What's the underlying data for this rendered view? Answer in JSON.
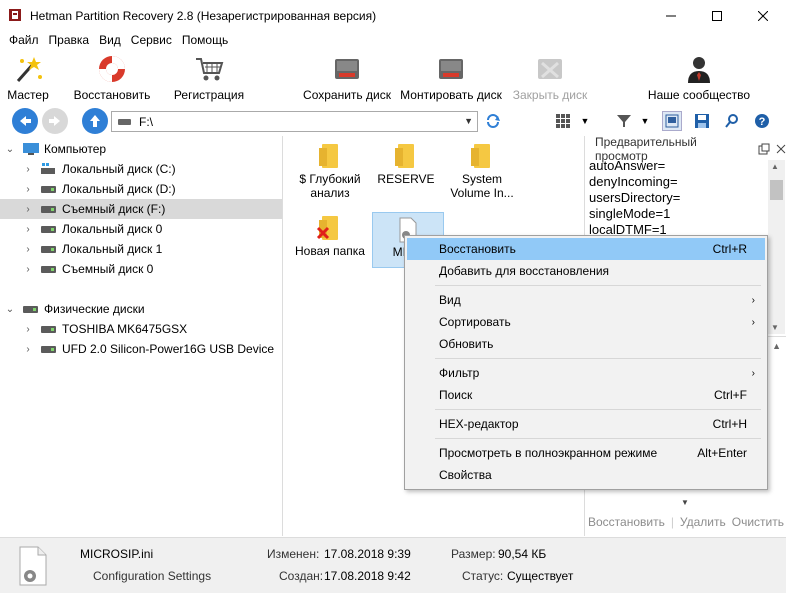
{
  "window": {
    "title": "Hetman Partition Recovery 2.8 (Незарегистрированная версия)",
    "minimize": "—",
    "maximize": "☐",
    "close": "✕"
  },
  "menu": [
    "Файл",
    "Правка",
    "Вид",
    "Сервис",
    "Помощь"
  ],
  "toolbar": {
    "wizard": "Мастер",
    "restore": "Восстановить",
    "register": "Регистрация",
    "save_disk": "Сохранить диск",
    "mount_disk": "Монтировать диск",
    "close_disk": "Закрыть диск",
    "community": "Наше сообщество"
  },
  "address": {
    "path": "F:\\"
  },
  "tree": {
    "computer": "Компьютер",
    "drives": [
      "Локальный диск (C:)",
      "Локальный диск (D:)",
      "Съемный диск (F:)",
      "Локальный диск 0",
      "Локальный диск 1",
      "Съемный диск 0"
    ],
    "physical": "Физические диски",
    "physical_drives": [
      "TOSHIBA MK6475GSX",
      "UFD 2.0 Silicon-Power16G USB Device"
    ]
  },
  "files": [
    {
      "name": "$ Глубокий анализ",
      "line1": "$ Глубокий",
      "line2": "анализ"
    },
    {
      "name": "RESERVE",
      "line1": "RESERVE",
      "line2": ""
    },
    {
      "name": "System Volume In...",
      "line1": "System",
      "line2": "Volume In..."
    },
    {
      "name": "Новая папка",
      "line1": "Новая папка",
      "line2": ""
    },
    {
      "name": "MICR",
      "line1": "MICR",
      "line2": ""
    }
  ],
  "preview": {
    "header": "Предварительный просмотр",
    "lines": [
      "autoAnswer=",
      "denyIncoming=",
      "usersDirectory=",
      "singleMode=1",
      "localDTMF=1"
    ],
    "actions": [
      "Восстановить",
      "Удалить",
      "Очистить"
    ]
  },
  "context_menu": [
    {
      "label": "Восстановить",
      "shortcut": "Ctrl+R"
    },
    {
      "label": "Добавить для восстановления",
      "shortcut": ""
    },
    {
      "label": "Вид",
      "shortcut": "›"
    },
    {
      "label": "Сортировать",
      "shortcut": "›"
    },
    {
      "label": "Обновить",
      "shortcut": ""
    },
    {
      "label": "Фильтр",
      "shortcut": "›"
    },
    {
      "label": "Поиск",
      "shortcut": "Ctrl+F"
    },
    {
      "label": "HEX-редактор",
      "shortcut": "Ctrl+H"
    },
    {
      "label": "Просмотреть в полноэкранном режиме",
      "shortcut": "Alt+Enter"
    },
    {
      "label": "Свойства",
      "shortcut": ""
    }
  ],
  "status": {
    "filename": "MICROSIP.ini",
    "type": "Configuration Settings",
    "modified_label": "Изменен:",
    "modified": "17.08.2018 9:39",
    "created_label": "Создан:",
    "created": "17.08.2018 9:42",
    "size_label": "Размер:",
    "size": "90,54 КБ",
    "status_label": "Статус:",
    "status": "Существует"
  },
  "colors": {
    "selection": "#d9d9d9",
    "menu_hover": "#91c9f7",
    "nav_blue": "#2f7fd6"
  }
}
